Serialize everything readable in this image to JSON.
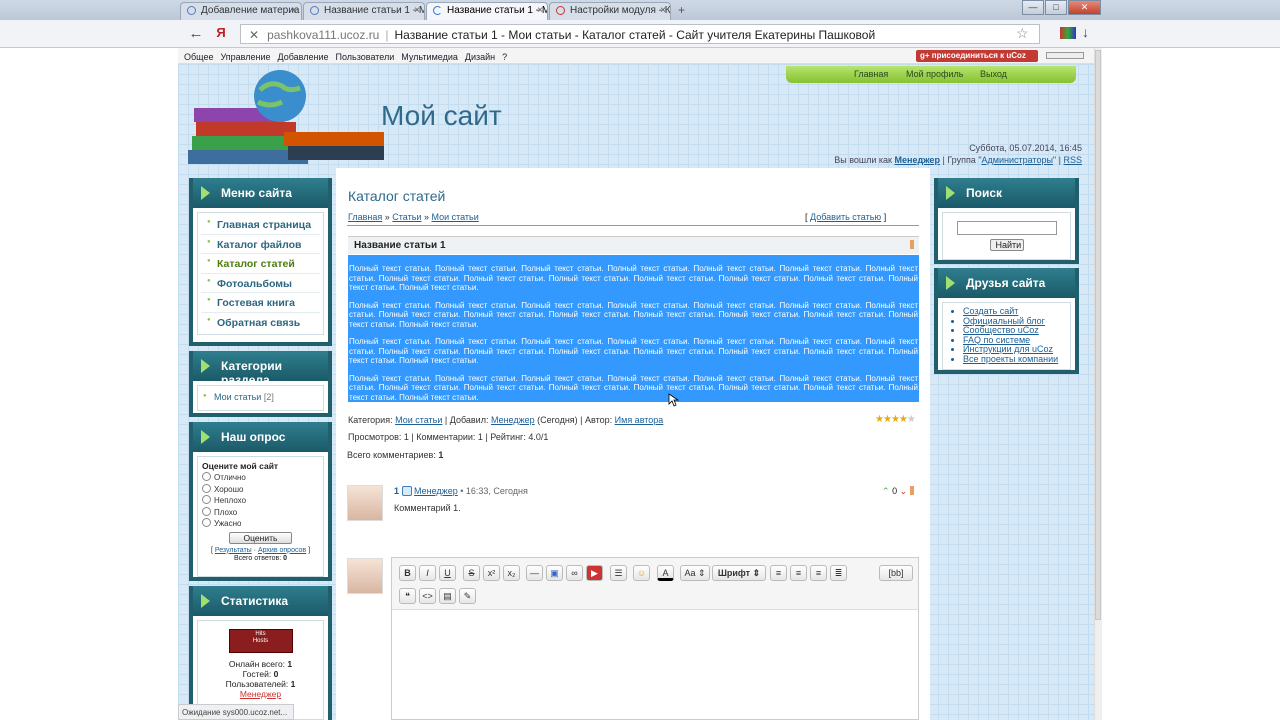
{
  "browser": {
    "tabs": [
      {
        "label": "Добавление материа"
      },
      {
        "label": "Название статьи 1 - М"
      },
      {
        "label": "Название статьи 1 - М"
      },
      {
        "label": "Настройки модуля - К"
      }
    ],
    "url_domain": "pashkova111.ucoz.ru",
    "url_title": "Название статьи 1 - Мои статьи - Каталог статей - Сайт учителя Екатерины Пашковой",
    "status": "Ожидание sys000.ucoz.net..."
  },
  "ucozbar": {
    "menu": [
      "Общее",
      "Управление",
      "Добавление",
      "Пользователи",
      "Мультимедиа",
      "Дизайн",
      "?"
    ],
    "join": "присоединиться к uCoz"
  },
  "header": {
    "site_title": "Мой сайт",
    "topnav": [
      "Главная",
      "Мой профиль",
      "Выход"
    ],
    "date": "Суббота, 05.07.2014, 16:45",
    "login_prefix": "Вы вошли как",
    "user": "Менеджер",
    "group_prefix": "| Группа \"",
    "group": "Администраторы",
    "group_suffix": "\" |",
    "rss": "RSS"
  },
  "sidebar_left": {
    "menu_title": "Меню сайта",
    "menu_items": [
      "Главная страница",
      "Каталог файлов",
      "Каталог статей",
      "Фотоальбомы",
      "Гостевая книга",
      "Обратная связь"
    ],
    "categories_title": "Категории раздела",
    "category": "Мои статьи",
    "category_count": "[2]",
    "poll_title": "Наш опрос",
    "poll_question": "Оцените мой сайт",
    "poll_options": [
      "Отлично",
      "Хорошо",
      "Неплохо",
      "Плохо",
      "Ужасно"
    ],
    "poll_button": "Оценить",
    "poll_results": "Результаты",
    "poll_archive": "Архив опросов",
    "poll_total_label": "Всего ответов:",
    "poll_total": "0",
    "stats_title": "Статистика",
    "counter_lines": [
      "Hits",
      "Hosts"
    ],
    "online_label": "Онлайн всего:",
    "online": "1",
    "guests_label": "Гостей:",
    "guests": "0",
    "users_label": "Пользователей:",
    "users": "1",
    "online_user": "Менеджер"
  },
  "content": {
    "title": "Каталог статей",
    "crumb_home": "Главная",
    "crumb_articles": "Статьи",
    "crumb_my": "Мои статьи",
    "add_article": "Добавить статью",
    "article_title": "Название статьи 1",
    "paragraph": "Полный текст статьи. Полный текст статьи. Полный текст статьи. Полный текст статьи. Полный текст статьи. Полный текст статьи. Полный текст статьи. Полный текст статьи. Полный текст статьи. Полный текст статьи. Полный текст статьи. Полный текст статьи. Полный текст статьи. Полный текст статьи. Полный текст статьи.",
    "category_label": "Категория:",
    "category": "Мои статьи",
    "added_label": "Добавил:",
    "added_by": "Менеджер",
    "added_when": "(Сегодня)",
    "author_label": "Автор:",
    "author": "Имя автора",
    "views": "Просмотров: 1",
    "comments": "Комментарии: 1",
    "rating": "Рейтинг: 4.0/1",
    "rating_value": 4,
    "rating_max": 5,
    "all_comments": "Всего комментариев:",
    "all_comments_count": "1",
    "comment_num": "1",
    "comment_user": "Менеджер",
    "comment_time": "• 16:33, Сегодня",
    "comment_text": "Комментарий 1.",
    "comment_votes": "0"
  },
  "editor": {
    "font_label": "Шрифт",
    "bb_label": "[bb]"
  },
  "sidebar_right": {
    "search_title": "Поиск",
    "search_button": "Найти",
    "friends_title": "Друзья сайта",
    "friends": [
      "Создать сайт",
      "Официальный блог",
      "Сообщество uCoz",
      "FAQ по системе",
      "Инструкции для uCoz",
      "Все проекты компании"
    ]
  }
}
